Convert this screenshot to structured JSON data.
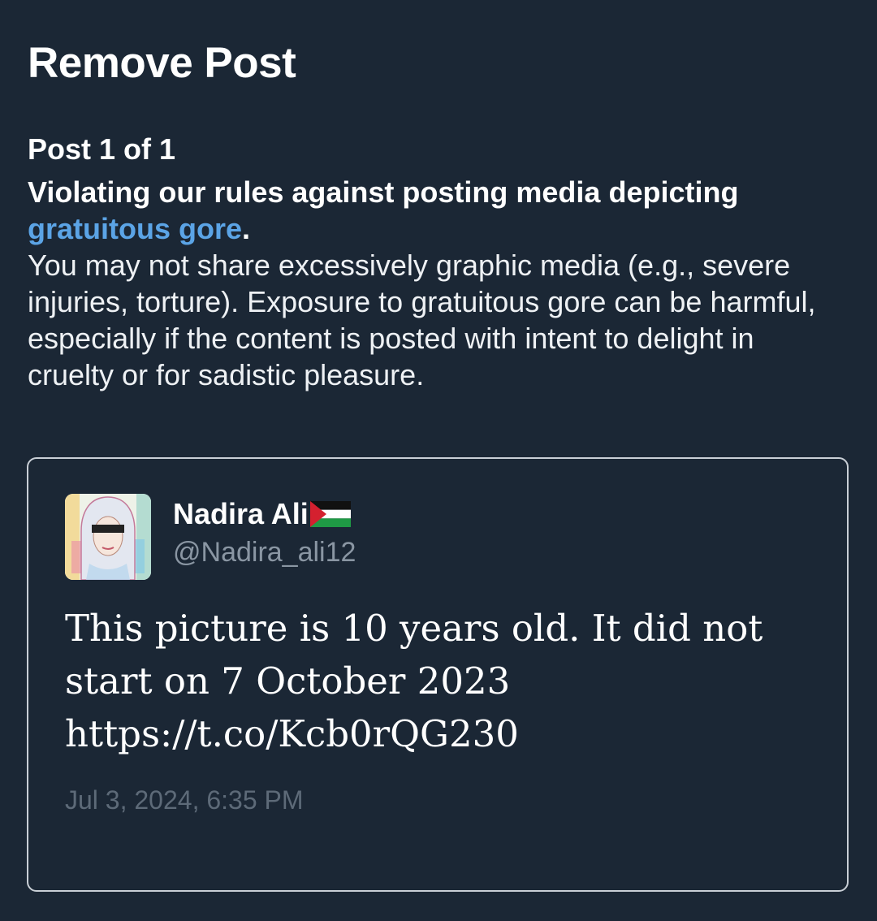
{
  "page": {
    "title": "Remove Post",
    "counter": "Post 1 of 1"
  },
  "violation": {
    "heading": "Violating our rules against posting media depicting ",
    "rule_link": "gratuitous gore",
    "heading_end": ".",
    "body": "You may not share excessively graphic media (e.g., severe injuries, torture). Exposure to gratuitous gore can be harmful, especially if the content is posted with intent to delight in cruelty or for sadistic pleasure."
  },
  "post": {
    "author_name": "Nadira Ali",
    "author_flag_icon": "palestine-flag-icon",
    "author_handle": "@Nadira_ali12",
    "text": "This picture is 10 years old. It did not start on 7 October 2023 https://t.co/Kcb0rQG230",
    "timestamp": "Jul 3, 2024, 6:35 PM"
  },
  "colors": {
    "background": "#1b2735",
    "link": "#5ba4e6",
    "card_border": "#c9cfd6",
    "handle": "#8a96a3",
    "timestamp": "#5d6a78"
  }
}
